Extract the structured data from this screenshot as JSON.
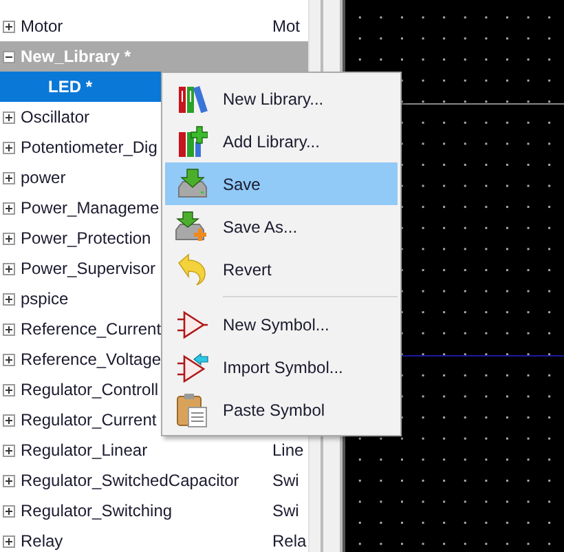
{
  "tree": {
    "rows": [
      {
        "name": "Motor",
        "column_2": "Mot",
        "expanded": false,
        "active": false,
        "selected": false
      },
      {
        "name": "New_Library *",
        "expanded": true,
        "active": true,
        "selected": false,
        "children": [
          {
            "name": "LED *",
            "selected": true
          }
        ]
      },
      {
        "name": "Oscillator",
        "expanded": false,
        "active": false,
        "selected": false
      },
      {
        "name": "Potentiometer_Dig",
        "expanded": false,
        "active": false,
        "selected": false
      },
      {
        "name": "power",
        "expanded": false,
        "active": false,
        "selected": false
      },
      {
        "name": "Power_Manageme",
        "expanded": false,
        "active": false,
        "selected": false
      },
      {
        "name": "Power_Protection",
        "expanded": false,
        "active": false,
        "selected": false
      },
      {
        "name": "Power_Supervisor",
        "expanded": false,
        "active": false,
        "selected": false
      },
      {
        "name": "pspice",
        "expanded": false,
        "active": false,
        "selected": false
      },
      {
        "name": "Reference_Current",
        "expanded": false,
        "active": false,
        "selected": false
      },
      {
        "name": "Reference_Voltage",
        "expanded": false,
        "active": false,
        "selected": false
      },
      {
        "name": "Regulator_Controll",
        "expanded": false,
        "active": false,
        "selected": false
      },
      {
        "name": "Regulator_Current",
        "expanded": false,
        "active": false,
        "selected": false
      },
      {
        "name": "Regulator_Linear",
        "column_2": "Line",
        "expanded": false,
        "active": false,
        "selected": false
      },
      {
        "name": "Regulator_SwitchedCapacitor",
        "column_2": "Swi",
        "expanded": false,
        "active": false,
        "selected": false
      },
      {
        "name": "Regulator_Switching",
        "column_2": "Swi",
        "expanded": false,
        "active": false,
        "selected": false
      },
      {
        "name": "Relay",
        "column_2": "Rela",
        "expanded": false,
        "active": false,
        "selected": false
      }
    ]
  },
  "context_menu": {
    "groups": [
      [
        {
          "label": "New Library...",
          "selected": false
        },
        {
          "label": "Add Library...",
          "selected": false
        },
        {
          "label": "Save",
          "selected": true
        },
        {
          "label": "Save As...",
          "selected": false
        },
        {
          "label": "Revert",
          "selected": false
        }
      ],
      [
        {
          "label": "New Symbol...",
          "selected": false
        },
        {
          "label": "Import Symbol...",
          "selected": false
        },
        {
          "label": "Paste Symbol",
          "selected": false
        }
      ]
    ]
  }
}
